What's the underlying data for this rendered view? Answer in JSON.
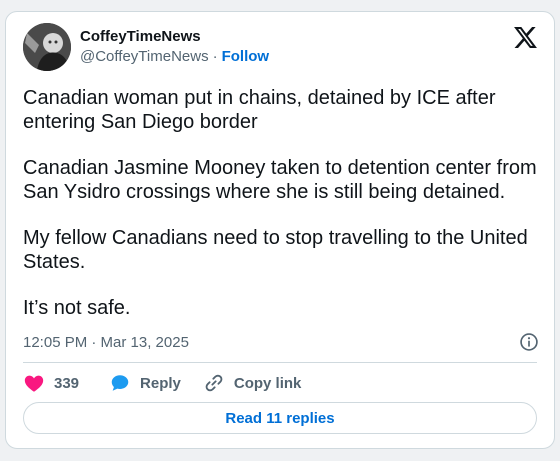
{
  "author": {
    "display_name": "CoffeyTimeNews",
    "handle": "@CoffeyTimeNews",
    "separator": "·",
    "follow_label": "Follow",
    "avatar_icon": "avatar-photo-icon"
  },
  "tweet": {
    "paragraphs": [
      "Canadian woman put in chains, detained by ICE after entering San Diego border",
      "Canadian Jasmine Mooney taken to detention center from San Ysidro crossings where she is still being detained.",
      "My fellow Canadians need to stop travelling to the United States.",
      "It’s not safe."
    ],
    "timestamp": "12:05 PM · Mar 13, 2025"
  },
  "actions": {
    "like_count": "339",
    "reply_label": "Reply",
    "copy_link_label": "Copy link",
    "read_replies_label": "Read 11 replies"
  },
  "colors": {
    "text": "#0f1419",
    "secondary": "#536471",
    "link_blue": "#006fd6",
    "like_pink": "#f91880",
    "reply_blue": "#1d9bf0",
    "border": "#cfd9de"
  }
}
